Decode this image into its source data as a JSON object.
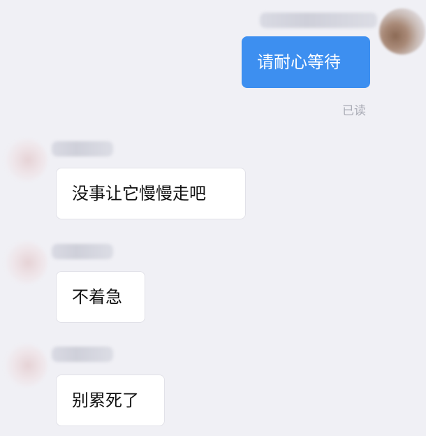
{
  "colors": {
    "background": "#f0f0f5",
    "outgoing_bubble": "#3d8ff0",
    "incoming_bubble": "#ffffff",
    "read_receipt": "#a9abb5"
  },
  "messages": [
    {
      "direction": "outgoing",
      "text": "请耐心等待",
      "status": "已读",
      "avatar": "blurred-avatar"
    },
    {
      "direction": "incoming",
      "text": "没事让它慢慢走吧",
      "avatar": "blurred-avatar"
    },
    {
      "direction": "incoming",
      "text": "不着急",
      "avatar": "blurred-avatar"
    },
    {
      "direction": "incoming",
      "text": "别累死了",
      "avatar": "blurred-avatar"
    }
  ]
}
